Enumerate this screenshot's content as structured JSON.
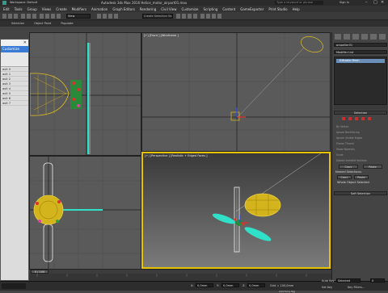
{
  "window": {
    "workspace": "Workspace: Default",
    "title": "Autodesk 3ds Max 2016    Helice_motor_airpart01.max",
    "search_placeholder": "Type a keyword or phrase",
    "sign_in": "Sign In"
  },
  "menu": [
    "Edit",
    "Tools",
    "Group",
    "Views",
    "Create",
    "Modifiers",
    "Animation",
    "Graph Editors",
    "Rendering",
    "Civil View",
    "Customize",
    "Scripting",
    "Content",
    "GameExporter",
    "Print Studio",
    "Help"
  ],
  "toolbar": {
    "view_dropdown": "View",
    "selection_set": "Create Selection Se"
  },
  "ribbon_tabs": [
    "Selection",
    "Object Paint",
    "Populate"
  ],
  "viewports": {
    "front": "[+] [Front ] [Wireframe ]",
    "perspective": "[+] [Perspective ] [Realistic + Edged Faces ]"
  },
  "dialog": {
    "caption": "Customize",
    "close_label": "✕",
    "rows": [
      "ault 0",
      "ault 1",
      "ault 2",
      "ault 3",
      "ault 4",
      "ault 5",
      "ault 6",
      "ault 7"
    ]
  },
  "command_panel": {
    "object_name": "propeller01",
    "modifier_list": "Modifier List",
    "stack_item": "Editable Mesh",
    "rollout_selection": "Selection",
    "checks": [
      "By Vertex",
      "Ignore Backfacing",
      "Ignore Visible Edges",
      "Planar Thresh",
      "Show Normals",
      "Scale",
      "Delete Isolated Vertices"
    ],
    "copy_label": "Copy",
    "paste_label": "Paste",
    "named_selections": "Named Selections:",
    "whole_object": "Whole Object Selected",
    "rollout_soft": "Soft Selection"
  },
  "statusbar": {
    "time": "0 / 100",
    "x_label": "X:",
    "x_value": "0,0mm",
    "y_label": "Y:",
    "y_value": "0,0mm",
    "z_label": "Z:",
    "z_value": "0,0mm",
    "grid": "Grid = 100,0mm",
    "add_time_tag": "Add Time Tag",
    "auto_key": "Auto Key",
    "selected": "Selected",
    "set_key": "Set Key",
    "key_filters": "Key Filters...",
    "frame": "0"
  }
}
